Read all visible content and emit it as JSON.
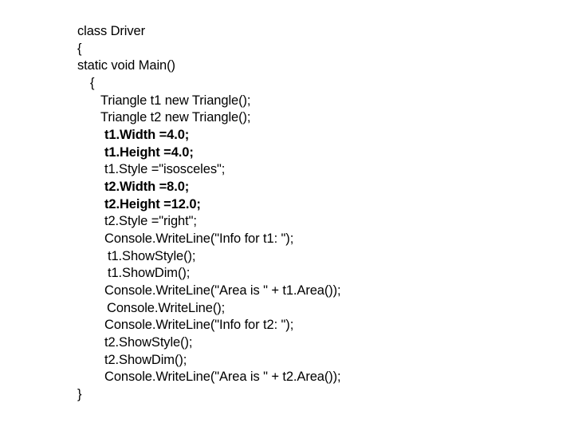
{
  "code": {
    "lines": [
      {
        "text": "class Driver",
        "weight": "normal"
      },
      {
        "text": "{",
        "weight": "normal"
      },
      {
        "text": "static void Main()",
        "weight": "normal"
      },
      {
        "text": "{",
        "weight": "normal"
      },
      {
        "text": "Triangle t1 new Triangle();",
        "weight": "normal"
      },
      {
        "text": "Triangle t2 new Triangle();",
        "weight": "normal"
      },
      {
        "text": "t1.Width =4.0;",
        "weight": "normal"
      },
      {
        "text": "t1.Height =4.0;",
        "weight": "normal"
      },
      {
        "text": "t1.Style =\"isosceles\";",
        "weight": "normal"
      },
      {
        "text": "t2.Width =8.0;",
        "weight": "normal"
      },
      {
        "text": "t2.Height =12.0;",
        "weight": "normal"
      },
      {
        "text": "t2.Style =\"right\";",
        "weight": "normal"
      },
      {
        "text": "Console.WriteLine(\"Info for t1: \");",
        "weight": "normal"
      },
      {
        "text": "t1.ShowStyle();",
        "weight": "normal"
      },
      {
        "text": "t1.ShowDim();",
        "weight": "normal"
      },
      {
        "text": "Console.WriteLine(\"Area is \" + t1.Area());",
        "weight": "normal"
      },
      {
        "text": "Console.WriteLine();",
        "weight": "normal"
      },
      {
        "text": "Console.WriteLine(\"Info for t2: \");",
        "weight": "normal"
      },
      {
        "text": "t2.ShowStyle();",
        "weight": "normal"
      },
      {
        "text": "t2.ShowDim();",
        "weight": "normal"
      },
      {
        "text": "Console.WriteLine(\"Area is \" + t2.Area());",
        "weight": "normal"
      },
      {
        "text": "}",
        "weight": "normal"
      }
    ]
  }
}
